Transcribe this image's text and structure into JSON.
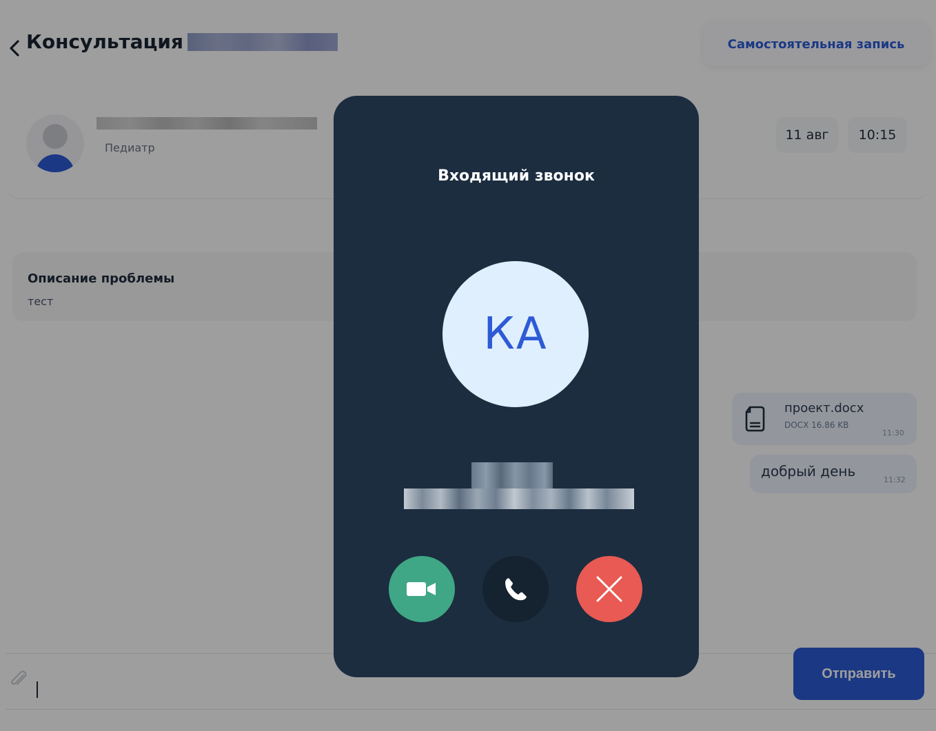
{
  "header": {
    "title": "Консультация",
    "self_booking_label": "Самостоятельная запись"
  },
  "doctor": {
    "role": "Педиатр",
    "date": "11 авг",
    "time": "10:15"
  },
  "problem": {
    "label": "Описание проблемы",
    "text": "тест"
  },
  "messages": [
    {
      "type": "file",
      "name": "проект.docx",
      "meta": "DOCX 16.86 KB",
      "time": "11:30"
    },
    {
      "type": "text",
      "text": "добрый день",
      "time": "11:32"
    }
  ],
  "composer": {
    "value": "",
    "send_label": "Отправить"
  },
  "call": {
    "title": "Входящий звонок",
    "initials": "КА"
  },
  "colors": {
    "brand_blue": "#2d5bd6",
    "modal_bg": "#1c2d40",
    "accept_video": "#3fa785",
    "accept_audio": "#15222f",
    "decline": "#e85a53"
  },
  "icons": {
    "back": "chevron-left-icon",
    "attach": "paperclip-icon",
    "file": "document-icon",
    "video": "video-camera-icon",
    "audio": "phone-icon",
    "decline": "close-icon"
  }
}
